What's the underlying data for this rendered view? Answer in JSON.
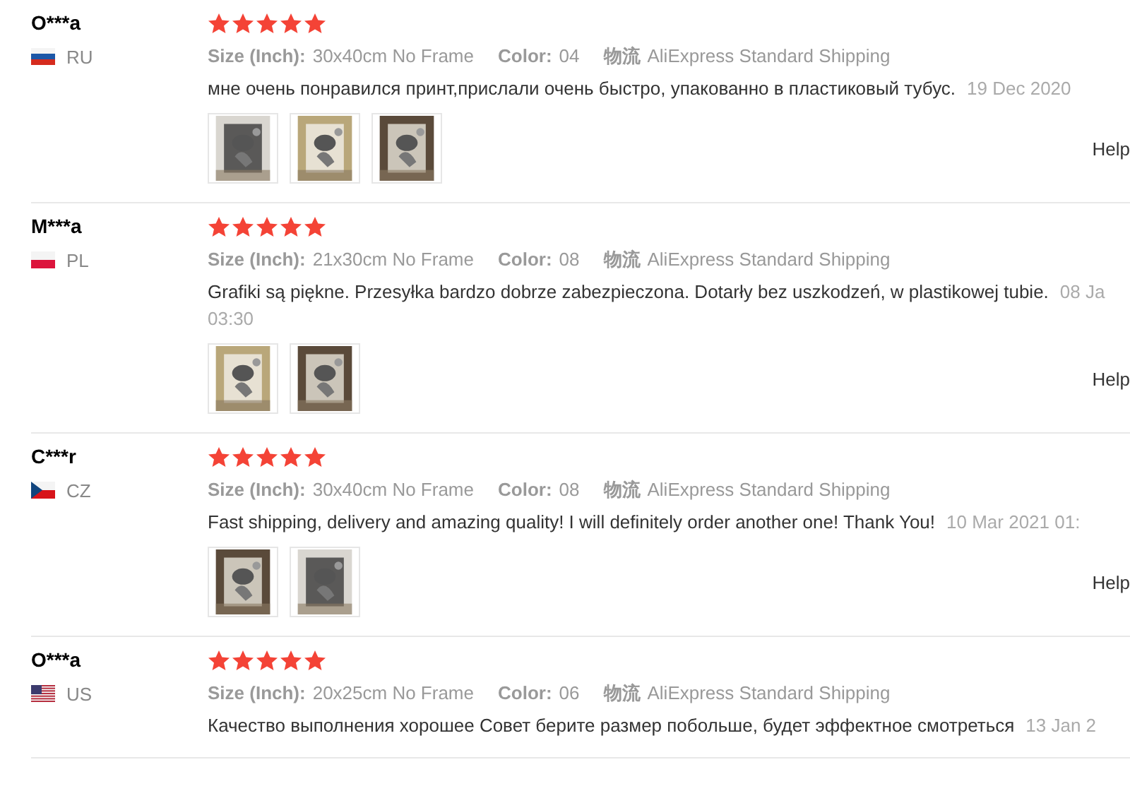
{
  "reviews": [
    {
      "name": "O***a",
      "country": "RU",
      "flag": {
        "kind": "ru"
      },
      "stars": 5,
      "size_label": "Size (Inch):",
      "size": "30x40cm No Frame",
      "color_label": "Color:",
      "color_option": "04",
      "shipping_label": "物流",
      "shipping": "AliExpress Standard Shipping",
      "text": "мне очень понравился принт,прислали очень быстро, упакованно в пластиковый тубус.",
      "date": "19 Dec 2020",
      "photos": [
        {
          "kind": "picture"
        },
        {
          "kind": "picture"
        },
        {
          "kind": "picture"
        }
      ],
      "helpful": "Help"
    },
    {
      "name": "M***a",
      "country": "PL",
      "flag": {
        "kind": "pl"
      },
      "stars": 5,
      "size_label": "Size (Inch):",
      "size": "21x30cm No Frame",
      "color_label": "Color:",
      "color_option": "08",
      "shipping_label": "物流",
      "shipping": "AliExpress Standard Shipping",
      "text": "Grafiki są piękne. Przesyłka bardzo dobrze zabezpieczona. Dotarły bez uszkodzeń, w plastikowej tubie.",
      "date": "08 Ja",
      "time": "03:30",
      "photos": [
        {
          "kind": "picture"
        },
        {
          "kind": "picture"
        }
      ],
      "helpful": "Help"
    },
    {
      "name": "C***r",
      "country": "CZ",
      "flag": {
        "kind": "cz"
      },
      "stars": 5,
      "size_label": "Size (Inch):",
      "size": "30x40cm No Frame",
      "color_label": "Color:",
      "color_option": "08",
      "shipping_label": "物流",
      "shipping": "AliExpress Standard Shipping",
      "text": "Fast shipping, delivery and amazing quality! I will definitely order another one! Thank You!",
      "date": "10 Mar 2021 01:",
      "photos": [
        {
          "kind": "picture"
        },
        {
          "kind": "picture"
        }
      ],
      "helpful": "Help"
    },
    {
      "name": "O***a",
      "country": "US",
      "flag": {
        "kind": "us"
      },
      "stars": 5,
      "size_label": "Size (Inch):",
      "size": "20x25cm No Frame",
      "color_label": "Color:",
      "color_option": "06",
      "shipping_label": "物流",
      "shipping": "AliExpress Standard Shipping",
      "text": "Качество выполнения хорошее Совет берите размер побольше, будет эффектное смотреться",
      "date": "13 Jan 2"
    }
  ]
}
